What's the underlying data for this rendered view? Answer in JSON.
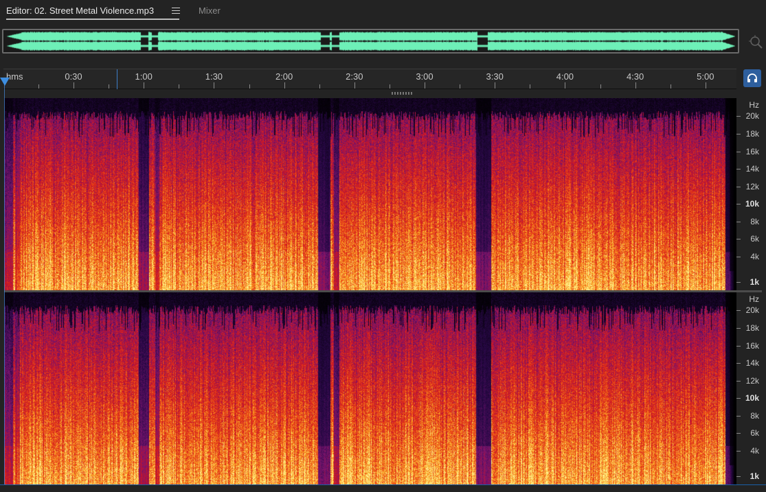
{
  "tabs": {
    "editor_label": "Editor: 02. Street Metal Violence.mp3",
    "mixer_label": "Mixer"
  },
  "ruler": {
    "unit_label": "hms",
    "time_labels": [
      "0:30",
      "1:00",
      "1:30",
      "2:00",
      "2:30",
      "3:00",
      "3:30",
      "4:00",
      "4:30",
      "5:00"
    ]
  },
  "frequency_axis": {
    "unit_label": "Hz",
    "labels": [
      "20k",
      "18k",
      "16k",
      "14k",
      "12k",
      "10k",
      "8k",
      "6k",
      "4k",
      "1k"
    ]
  },
  "colors": {
    "accent": "#3e8ee0",
    "waveform": "#6ef0b8",
    "spectrum_low": "#2a0a4a",
    "spectrum_mid": "#d01818",
    "spectrum_high": "#ffe26a"
  },
  "icons": {
    "tab_menu": "hamburger-icon",
    "zoom": "zoom-navigator-icon",
    "monitor": "headphones-icon",
    "playhead": "playhead-marker-icon"
  }
}
